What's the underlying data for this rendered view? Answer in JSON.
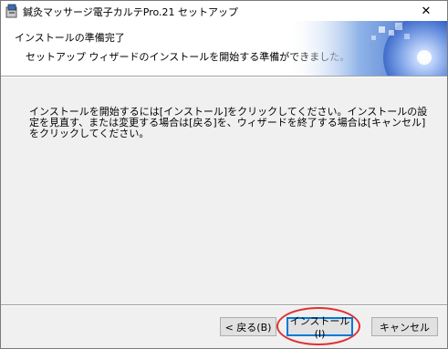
{
  "window": {
    "title": "鍼灸マッサージ電子カルテPro.21 セットアップ",
    "close_glyph": "✕"
  },
  "header": {
    "title": "インストールの準備完了",
    "subtitle": "セットアップ ウィザードのインストールを開始する準備ができました。"
  },
  "body": {
    "message": "インストールを開始するには[インストール]をクリックしてください。インストールの設定を見直す、または変更する場合は[戻る]を、ウィザードを終了する場合は[キャンセル]をクリックしてください。"
  },
  "buttons": {
    "back": "< 戻る(B)",
    "install": "インストール(I)",
    "cancel": "キャンセル"
  },
  "colors": {
    "annotation": "#e03030",
    "accent": "#0078d7"
  }
}
